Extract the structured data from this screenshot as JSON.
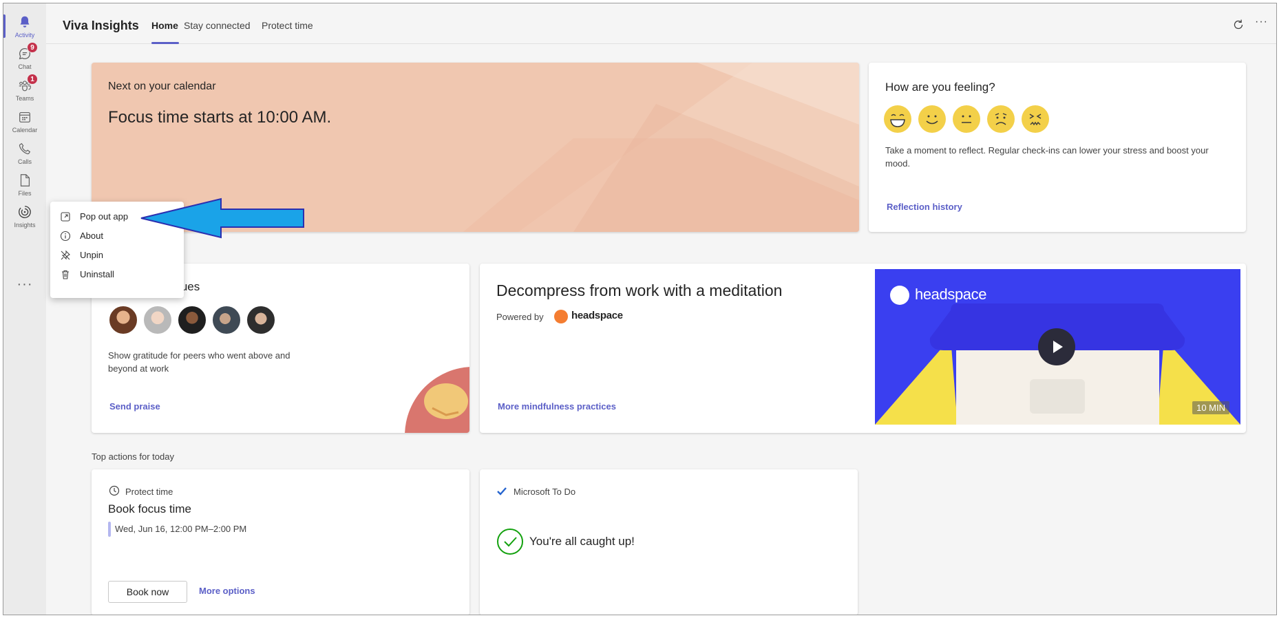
{
  "rail": {
    "items": [
      {
        "label": "Activity",
        "icon": "bell-icon"
      },
      {
        "label": "Chat",
        "icon": "chat-icon",
        "badge": "9"
      },
      {
        "label": "Teams",
        "icon": "teams-icon",
        "badge": "1"
      },
      {
        "label": "Calendar",
        "icon": "calendar-icon"
      },
      {
        "label": "Calls",
        "icon": "phone-icon"
      },
      {
        "label": "Files",
        "icon": "file-icon"
      },
      {
        "label": "Insights",
        "icon": "insights-icon"
      }
    ],
    "more": "···"
  },
  "header": {
    "title": "Viva Insights",
    "tabs": [
      {
        "label": "Home",
        "active": true
      },
      {
        "label": "Stay connected"
      },
      {
        "label": "Protect time"
      }
    ],
    "more": "···"
  },
  "calendar_card": {
    "label": "Next on your calendar",
    "text": "Focus time starts at 10:00 AM."
  },
  "feeling_card": {
    "title": "How are you feeling?",
    "description": "Take a moment to reflect. Regular check-ins can lower your stress and boost your mood.",
    "link": "Reflection history",
    "emojis": [
      "very-happy-face-icon",
      "happy-face-icon",
      "neutral-face-icon",
      "sad-face-icon",
      "stressed-face-icon"
    ]
  },
  "praise_card": {
    "title": "o your colleagues",
    "description": "Show gratitude for peers who went above and beyond at work",
    "link": "Send praise"
  },
  "meditation_card": {
    "title": "Decompress from work with a meditation",
    "powered_by": "Powered by",
    "brand": "headspace",
    "link": "More mindfulness practices",
    "video_brand": "headspace",
    "duration": "10 MIN"
  },
  "section": {
    "heading": "Top actions for today"
  },
  "focus_card": {
    "label": "Protect time",
    "title": "Book focus time",
    "time": "Wed, Jun 16, 12:00 PM–2:00 PM",
    "primary_button": "Book now",
    "secondary_link": "More options"
  },
  "todo_card": {
    "label": "Microsoft To Do",
    "message": "You're all caught up!"
  },
  "context_menu": {
    "items": [
      {
        "label": "Pop out app",
        "icon": "pop-out-icon"
      },
      {
        "label": "About",
        "icon": "info-icon"
      },
      {
        "label": "Unpin",
        "icon": "unpin-icon"
      },
      {
        "label": "Uninstall",
        "icon": "trash-icon"
      }
    ]
  },
  "colors": {
    "accent": "#5b5fc7",
    "badge": "#c4314b",
    "annotation_arrow": "#1aa3e8",
    "video_bg": "#3a3ff0"
  }
}
